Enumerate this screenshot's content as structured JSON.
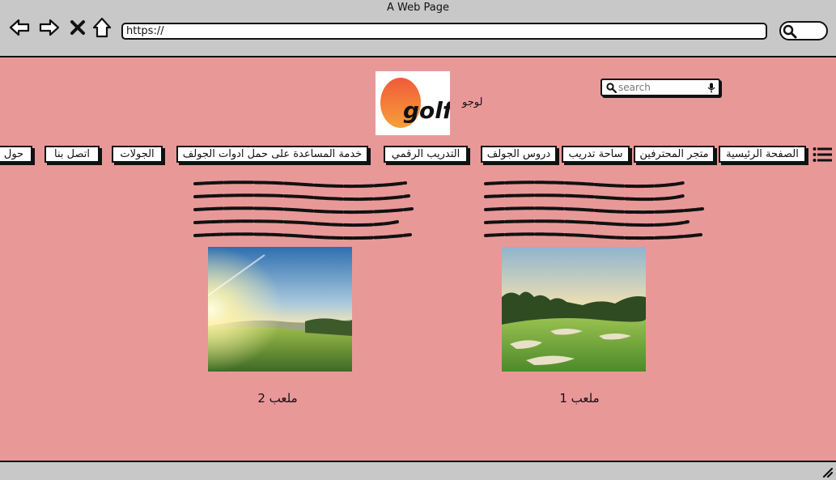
{
  "browser": {
    "window_title": "A Web Page",
    "url": "https://"
  },
  "header": {
    "logo_text": "golf",
    "logo_label": "لوجو",
    "search_placeholder": "search"
  },
  "nav": {
    "items": [
      {
        "label": "الصفحة الرئيسية"
      },
      {
        "label": "متجر المحترفين"
      },
      {
        "label": "ساحة تدريب"
      },
      {
        "label": "دروس الجولف"
      },
      {
        "label": "التدريب الرقمي"
      },
      {
        "label": "خدمة المساعدة على حمل ادوات الجولف"
      },
      {
        "label": "الجولات"
      },
      {
        "label": "اتصل بنا"
      },
      {
        "label": "حول"
      }
    ]
  },
  "courses": [
    {
      "caption": "ملعب 1"
    },
    {
      "caption": "ملعب 2"
    }
  ],
  "colors": {
    "page_background": "#e99898",
    "chrome": "#c8c8c8",
    "logo_orange": "#f07a3a"
  }
}
